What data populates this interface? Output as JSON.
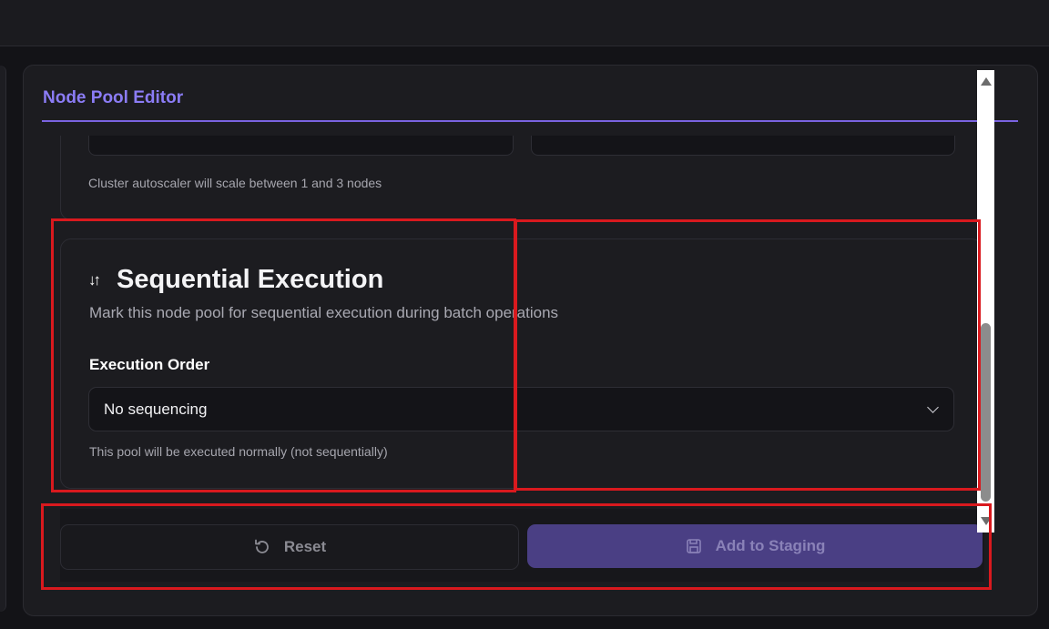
{
  "editor": {
    "title": "Node Pool Editor"
  },
  "autoscaler": {
    "helper_text": "Cluster autoscaler will scale between 1 and 3 nodes"
  },
  "sequential": {
    "icon": "sort-arrows-icon",
    "icon_glyph": "↓↑",
    "title": "Sequential Execution",
    "description": "Mark this node pool for sequential execution during batch operations",
    "field_label": "Execution Order",
    "selected_value": "No sequencing",
    "helper_text": "This pool will be executed normally (not sequentially)"
  },
  "actions": {
    "reset_label": "Reset",
    "add_label": "Add to Staging"
  },
  "colors": {
    "accent": "#7a63e0",
    "primary_button": "#4a3f84",
    "annotation_red": "#d9191e"
  }
}
